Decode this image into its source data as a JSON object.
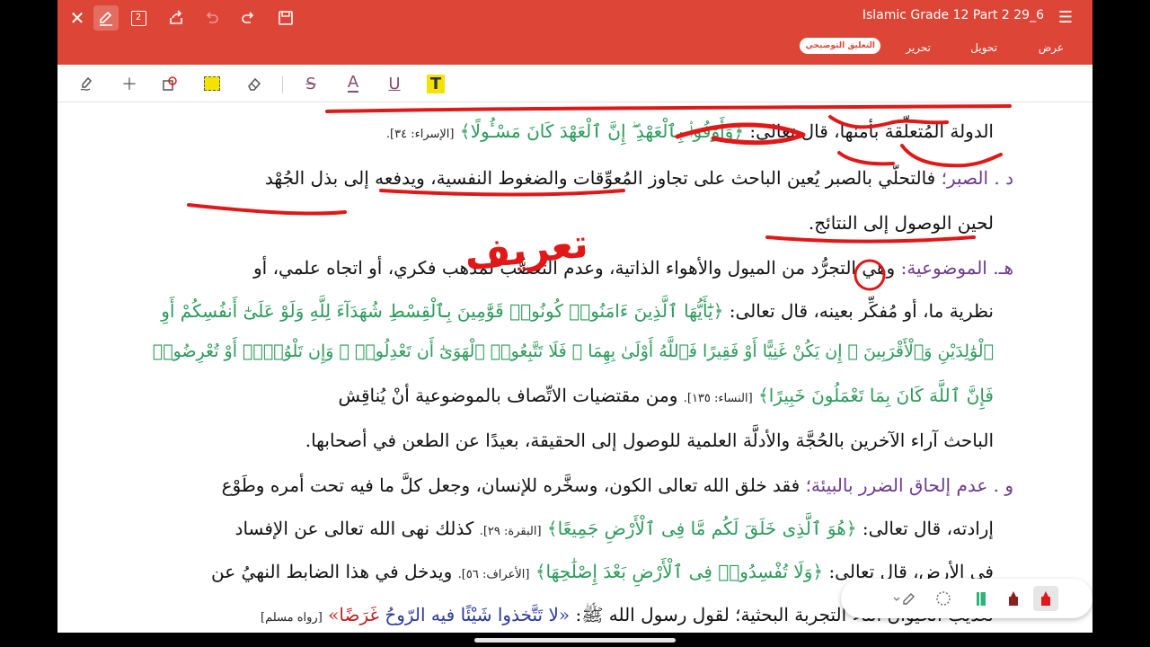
{
  "app_bar": {
    "doc_title": "Islamic Grade 12 Part 2 29_6",
    "tabs": [
      "عرض",
      "تحويل",
      "تحرير",
      "التعليق التوضيحي"
    ],
    "active_tab": "التعليق التوضيحي",
    "page_badge": "2"
  },
  "document": {
    "lines": {
      "l1_text": "الدولة المُتعلِّقة بأمنها، قال تعالى:",
      "l1_verse": "﴿وَأَوْفُوا۟ بِٱلْعَهْدِ ۖ إِنَّ ٱلْعَهْدَ كَانَ مَسْـُٔولًا﴾",
      "l1_ref": "[الإسراء: ٣٤].",
      "l2_head": "د . الصبر؛",
      "l2_text": "فالتحلّي بالصبر يُعين الباحث على تجاوز المُعوِّقات والضغوط النفسية، ويدفعه إلى بذل الجُهْد",
      "l3_text": "لحين الوصول إلى النتائج.",
      "l4_head": "هـ. الموضوعية:",
      "l4_text": "وهي التجرُّد من الميول والأهواء الذاتية، وعدم التعصُّب لمذهب فكري، أو اتجاه علمي، أو",
      "l5_text": "نظرية ما، أو مُفكِّر بعينه، قال تعالى:",
      "l5_verse": "﴿يَٰٓأَيُّهَا ٱلَّذِينَ ءَامَنُوا۟ كُونُوا۟ قَوَّٰمِينَ بِٱلْقِسْطِ شُهَدَآءَ لِلَّهِ وَلَوْ عَلَىٰٓ أَنفُسِكُمْ أَوِ",
      "l6_verse": "ٱلْوَٰلِدَيْنِ وَٱلْأَقْرَبِينَ ۚ إِن يَكُنْ غَنِيًّا أَوْ فَقِيرًا فَٱللَّهُ أَوْلَىٰ بِهِمَا ۖ فَلَا تَتَّبِعُوا۟ ٱلْهَوَىٰٓ أَن تَعْدِلُوا۟ ۚ وَإِن تَلْوُۥٓا۟ أَوْ تُعْرِضُوا۟",
      "l7_verse": "فَإِنَّ ٱللَّهَ كَانَ بِمَا تَعْمَلُونَ خَبِيرًا﴾",
      "l7_ref": "[النساء: ١٣٥].",
      "l7_text": "ومن مقتضيات الاتِّصاف بالموضوعية أنْ يُناقِش",
      "l8_text": "الباحث آراء الآخرين بالحُجَّة والأدلَّة العلمية للوصول إلى الحقيقة، بعيدًا عن الطعن في أصحابها.",
      "l9_head": "و . عدم إلحاق الضرر بالبيئة؛",
      "l9_text": "فقد خلق الله تعالى الكون، وسخَّره للإنسان، وجعل كلَّ ما فيه تحت أمره وطَوْع",
      "l10_text": "إرادته، قال تعالى:",
      "l10_verse": "﴿هُوَ ٱلَّذِى خَلَقَ لَكُم مَّا فِى ٱلْأَرْضِ جَمِيعًا﴾",
      "l10_ref": "[البقرة: ٢٩].",
      "l10_text2": "كذلك نهى الله تعالى عن الإفساد",
      "l11_text": "في الأرض، قال تعالى:",
      "l11_verse": "﴿وَلَا تُفْسِدُوا۟ فِى ٱلْأَرْضِ بَعْدَ إِصْلَٰحِهَا﴾",
      "l11_ref": "[الأعراف: ٥٦].",
      "l11_text2": "ويدخل في هذا الضابط النهيُ عن",
      "l12_text": "تعذيب الحيوان أثناء التجربة البحثية؛ لقول رسول الله ﷺ:",
      "l12_hadith": "«لا تَتَّخذوا شَيْئًا فيه الرّوحُ",
      "l12_hadith_red": "غَرَضًا»",
      "l12_ref": "[رواه مسلم]"
    },
    "handwriting": "تعريف"
  },
  "colors": {
    "appbar": "#dd4537",
    "heading_purple": "#6b3a8c",
    "verse_green": "#2b9a5a",
    "ink_red": "#e01818",
    "highlight_yellow": "#f4e300"
  }
}
